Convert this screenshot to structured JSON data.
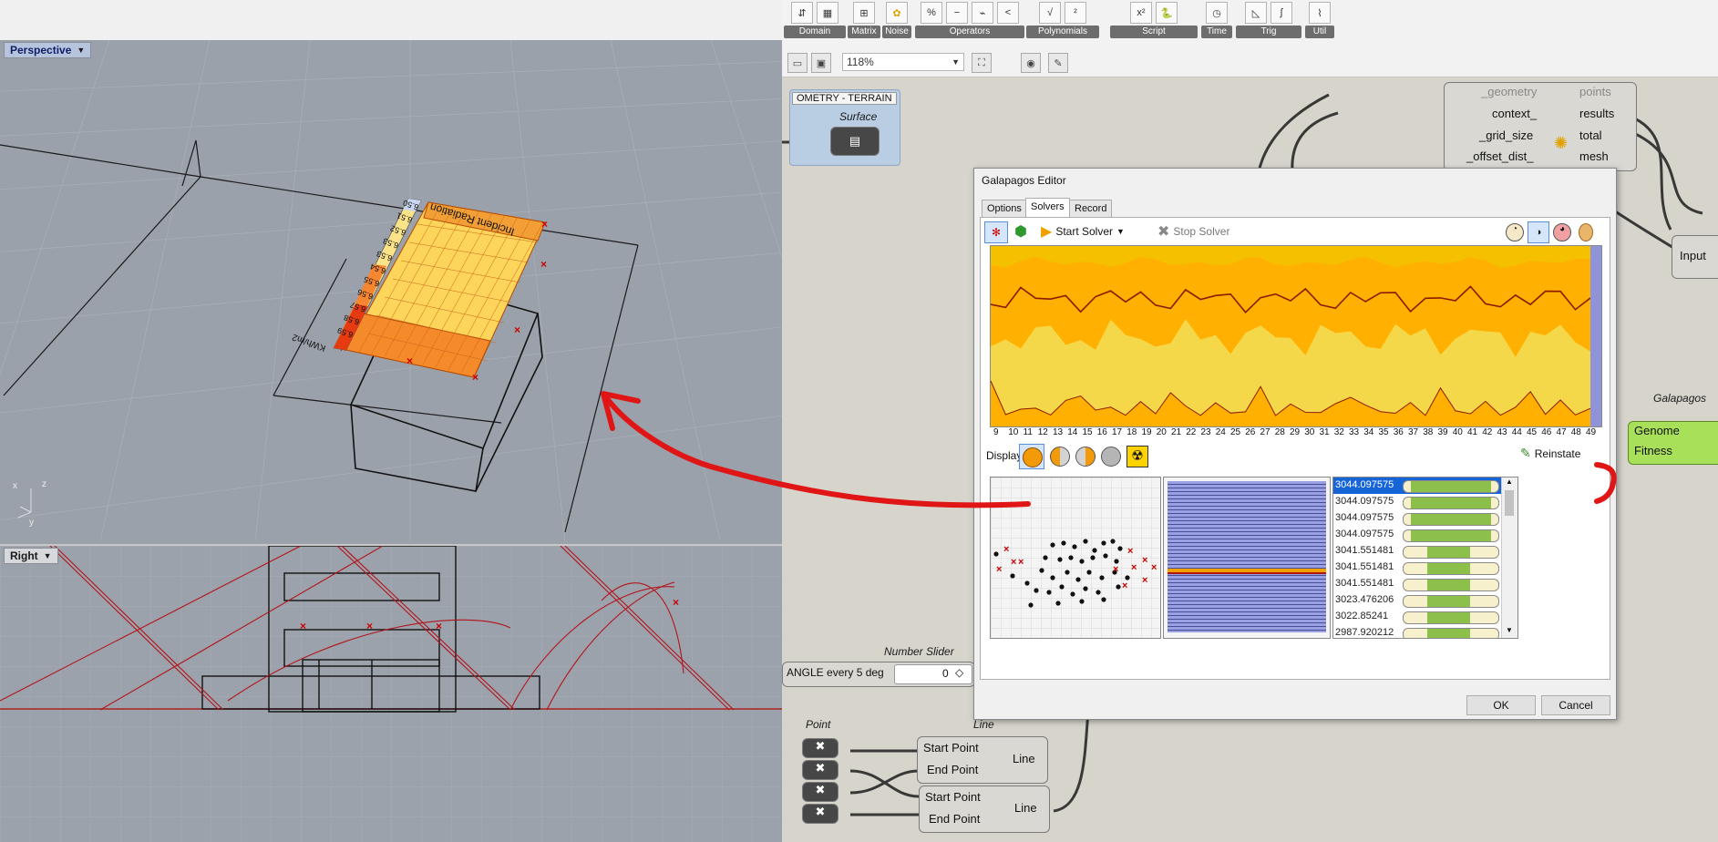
{
  "rhino": {
    "viewports": {
      "perspective_label": "Perspective",
      "right_label": "Right"
    },
    "legend": {
      "title": "Incident Radiation",
      "unit": "KWh/m2",
      "values": [
        "6.50",
        "6.51",
        "6.52",
        "6.53",
        "6.53",
        "6.54",
        "6.55",
        "6.56",
        "6.57",
        "6.58",
        "6.59"
      ]
    },
    "axes": {
      "x": "x",
      "y": "y",
      "z": "z"
    }
  },
  "grasshopper": {
    "ribbon": {
      "groups": [
        "Domain",
        "Matrix",
        "Noise",
        "Operators",
        "Polynomials",
        "Script",
        "Time",
        "Trig",
        "Util"
      ]
    },
    "toolbar": {
      "zoom": "118%"
    },
    "canvas": {
      "geometry_group": "OMETRY - TERRAIN",
      "surface_label": "Surface",
      "ladybug_inputs": [
        "_geometry",
        "context_",
        "_grid_size",
        "_offset_dist_"
      ],
      "ladybug_outputs": [
        "points",
        "results",
        "total",
        "mesh"
      ],
      "input_label": "Input",
      "galapagos_label": "Galapagos",
      "galapagos_ports": [
        "Genome",
        "Fitness"
      ],
      "number_slider_label": "Number Slider",
      "slider_text": "ANGLE every 5 deg",
      "slider_value": "0",
      "point_label": "Point",
      "line_label": "Line",
      "line_component": {
        "start": "Start Point",
        "end": "End Point",
        "out": "Line"
      }
    },
    "galapagos_editor": {
      "title": "Galapagos Editor",
      "tabs": [
        "Options",
        "Solvers",
        "Record"
      ],
      "start_solver": "Start Solver",
      "stop_solver": "Stop Solver",
      "display_label": "Display",
      "reinstate": "Reinstate",
      "ok": "OK",
      "cancel": "Cancel",
      "x_ticks": [
        "9",
        "10",
        "11",
        "12",
        "13",
        "14",
        "15",
        "16",
        "17",
        "18",
        "19",
        "20",
        "21",
        "22",
        "23",
        "24",
        "25",
        "26",
        "27",
        "28",
        "29",
        "30",
        "31",
        "32",
        "33",
        "34",
        "35",
        "36",
        "37",
        "38",
        "39",
        "40",
        "41",
        "42",
        "43",
        "44",
        "45",
        "46",
        "47",
        "48",
        "49"
      ],
      "fitness_list": [
        {
          "value": "3044.097575",
          "fill": [
            0.08,
            0.92
          ],
          "selected": true
        },
        {
          "value": "3044.097575",
          "fill": [
            0.08,
            0.92
          ],
          "selected": false
        },
        {
          "value": "3044.097575",
          "fill": [
            0.08,
            0.92
          ],
          "selected": false
        },
        {
          "value": "3044.097575",
          "fill": [
            0.08,
            0.92
          ],
          "selected": false
        },
        {
          "value": "3041.551481",
          "fill": [
            0.25,
            0.7
          ],
          "selected": false
        },
        {
          "value": "3041.551481",
          "fill": [
            0.25,
            0.7
          ],
          "selected": false
        },
        {
          "value": "3041.551481",
          "fill": [
            0.25,
            0.7
          ],
          "selected": false
        },
        {
          "value": "3023.476206",
          "fill": [
            0.25,
            0.7
          ],
          "selected": false
        },
        {
          "value": "3022.85241",
          "fill": [
            0.25,
            0.7
          ],
          "selected": false
        },
        {
          "value": "2987.920212",
          "fill": [
            0.25,
            0.7
          ],
          "selected": false
        }
      ],
      "colors": {
        "band_top": "#ffb000",
        "band_mid": "#ff9a00",
        "band_low": "#f5d84a",
        "line": "#8b1a00",
        "accent": "#1565d8"
      }
    }
  }
}
